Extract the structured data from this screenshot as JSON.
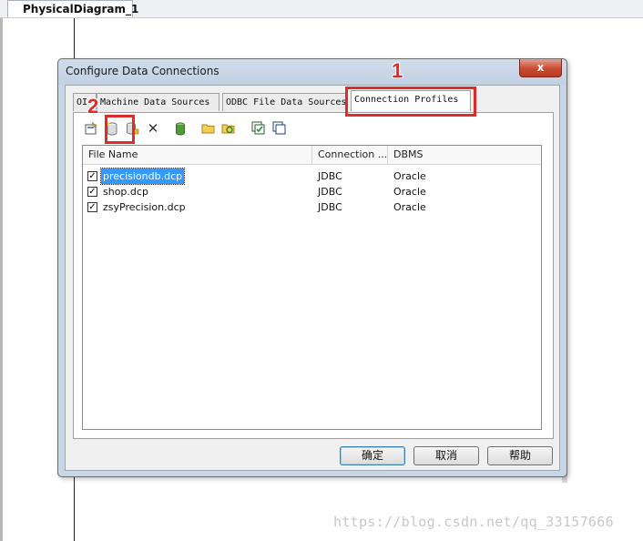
{
  "document_tab": {
    "label": "PhysicalDiagram_1"
  },
  "dialog": {
    "title": "Configure Data Connections",
    "close_glyph": "x",
    "tabs": [
      {
        "label": "ODBC Machine Data Sources",
        "visible_prefix": "OI"
      },
      {
        "label": "Machine Data Sources"
      },
      {
        "label": "ODBC File Data Sources"
      },
      {
        "label": "Connection Profiles"
      }
    ],
    "toolbar": {
      "icons": [
        "properties-icon",
        "new-profile-icon",
        "copy-profile-icon",
        "delete-icon",
        "test-connection-icon",
        "open-folder-icon",
        "refresh-icon",
        "check-all-icon",
        "uncheck-all-icon"
      ],
      "delete_glyph": "✕"
    },
    "list": {
      "columns": [
        "File Name",
        "Connection ...",
        "DBMS"
      ],
      "rows": [
        {
          "checked": true,
          "file": "precisiondb.dcp",
          "connection": "JDBC",
          "dbms": "Oracle",
          "selected": true
        },
        {
          "checked": true,
          "file": "shop.dcp",
          "connection": "JDBC",
          "dbms": "Oracle",
          "selected": false
        },
        {
          "checked": true,
          "file": "zsyPrecision.dcp",
          "connection": "JDBC",
          "dbms": "Oracle",
          "selected": false
        }
      ]
    },
    "buttons": {
      "ok": "确定",
      "cancel": "取消",
      "help": "帮助"
    }
  },
  "annotations": {
    "marker_1": "1",
    "marker_2": "2",
    "color": "#e12b2b"
  },
  "watermark": "https://blog.csdn.net/qq_33157666"
}
